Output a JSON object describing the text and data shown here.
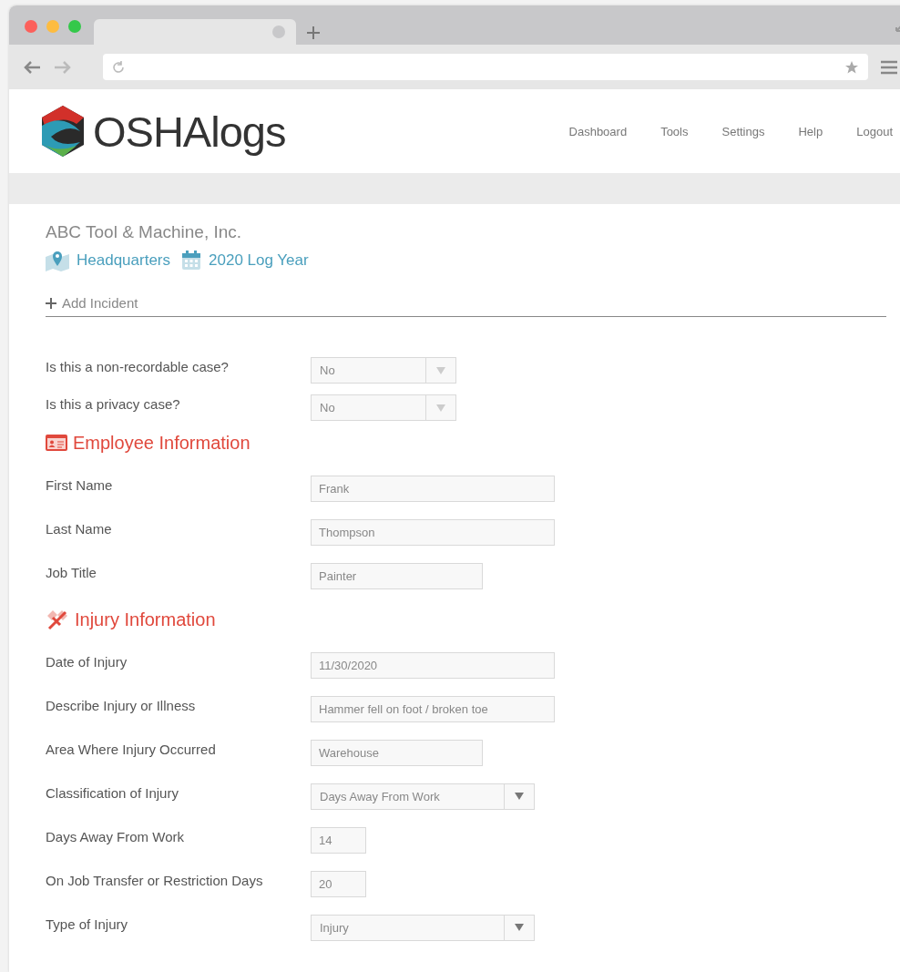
{
  "nav": [
    "Dashboard",
    "Tools",
    "Settings",
    "Help",
    "Logout"
  ],
  "logo": {
    "text": "OSHAlogs"
  },
  "company": "ABC Tool & Machine, Inc.",
  "location": "Headquarters",
  "log_year": "2020 Log Year",
  "add_incident": "Add Incident",
  "questions": [
    {
      "label": "Is this a non-recordable case?",
      "kind": "select",
      "value": "No"
    },
    {
      "label": "Is this a privacy case?",
      "kind": "select",
      "value": "No"
    }
  ],
  "sections": [
    {
      "title": "Employee Information",
      "kind": "employee",
      "fields": [
        {
          "label": "First Name",
          "kind": "text",
          "value": "Frank"
        },
        {
          "label": "Last Name",
          "kind": "text",
          "value": "Thompson"
        },
        {
          "label": "Job Title",
          "kind": "text",
          "value": "Painter"
        }
      ]
    },
    {
      "title": "Injury Information",
      "kind": "injury",
      "fields": [
        {
          "label": "Date of Injury",
          "kind": "text",
          "value": "11/30/2020"
        },
        {
          "label": "Describe Injury or Illness",
          "kind": "text",
          "value": "Hammer fell on foot / broken toe"
        },
        {
          "label": "Area Where Injury Occurred",
          "kind": "text",
          "value": "Warehouse"
        },
        {
          "label": "Classification of Injury",
          "kind": "select",
          "value": "Days Away From Work"
        },
        {
          "label": "Days Away From Work",
          "kind": "text",
          "value": "14"
        },
        {
          "label": "On Job Transfer or Restriction Days",
          "kind": "text",
          "value": "20"
        },
        {
          "label": "Type of Injury",
          "kind": "select",
          "value": "Injury"
        }
      ]
    }
  ]
}
